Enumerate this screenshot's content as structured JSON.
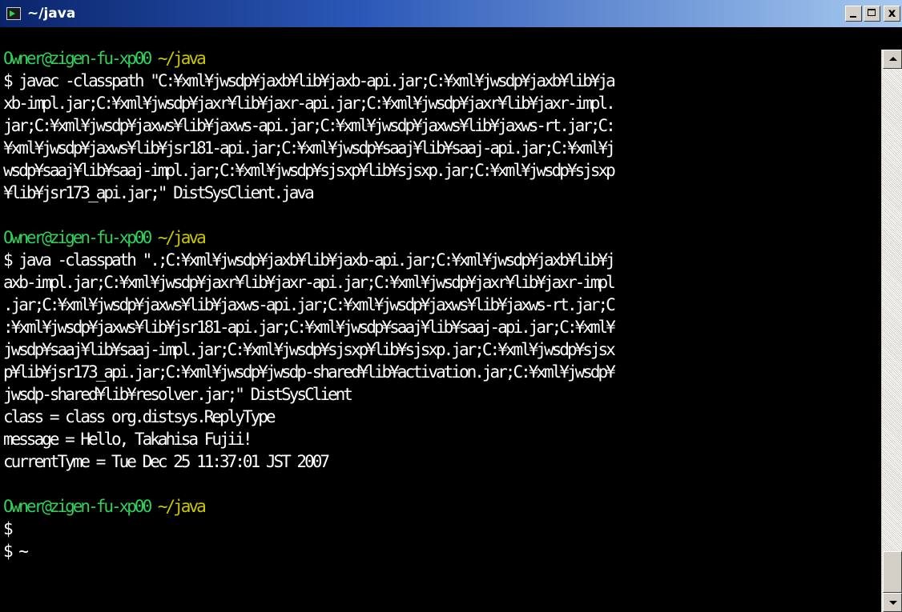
{
  "window": {
    "title": "~/java",
    "buttons": {
      "minimize": "_",
      "maximize": "□",
      "close": "x"
    },
    "colors": {
      "prompt_user": "#2fd15a",
      "prompt_path": "#c8c800",
      "text": "#ffffff",
      "background": "#000000"
    }
  },
  "console": {
    "lines": [
      {
        "type": "prompt",
        "user": "Owner@zigen-fu-xp00",
        "path": "~/java"
      },
      {
        "type": "text",
        "text": "$ javac -classpath \"C:¥xml¥jwsdp¥jaxb¥lib¥jaxb-api.jar;C:¥xml¥jwsdp¥jaxb¥lib¥ja"
      },
      {
        "type": "text",
        "text": "xb-impl.jar;C:¥xml¥jwsdp¥jaxr¥lib¥jaxr-api.jar;C:¥xml¥jwsdp¥jaxr¥lib¥jaxr-impl."
      },
      {
        "type": "text",
        "text": "jar;C:¥xml¥jwsdp¥jaxws¥lib¥jaxws-api.jar;C:¥xml¥jwsdp¥jaxws¥lib¥jaxws-rt.jar;C:"
      },
      {
        "type": "text",
        "text": "¥xml¥jwsdp¥jaxws¥lib¥jsr181-api.jar;C:¥xml¥jwsdp¥saaj¥lib¥saaj-api.jar;C:¥xml¥j"
      },
      {
        "type": "text",
        "text": "wsdp¥saaj¥lib¥saaj-impl.jar;C:¥xml¥jwsdp¥sjsxp¥lib¥sjsxp.jar;C:¥xml¥jwsdp¥sjsxp"
      },
      {
        "type": "text",
        "text": "¥lib¥jsr173_api.jar;\" DistSysClient.java"
      },
      {
        "type": "text",
        "text": ""
      },
      {
        "type": "prompt",
        "user": "Owner@zigen-fu-xp00",
        "path": "~/java"
      },
      {
        "type": "text",
        "text": "$ java -classpath \".;C:¥xml¥jwsdp¥jaxb¥lib¥jaxb-api.jar;C:¥xml¥jwsdp¥jaxb¥lib¥j"
      },
      {
        "type": "text",
        "text": "axb-impl.jar;C:¥xml¥jwsdp¥jaxr¥lib¥jaxr-api.jar;C:¥xml¥jwsdp¥jaxr¥lib¥jaxr-impl"
      },
      {
        "type": "text",
        "text": ".jar;C:¥xml¥jwsdp¥jaxws¥lib¥jaxws-api.jar;C:¥xml¥jwsdp¥jaxws¥lib¥jaxws-rt.jar;C"
      },
      {
        "type": "text",
        "text": ":¥xml¥jwsdp¥jaxws¥lib¥jsr181-api.jar;C:¥xml¥jwsdp¥saaj¥lib¥saaj-api.jar;C:¥xml¥"
      },
      {
        "type": "text",
        "text": "jwsdp¥saaj¥lib¥saaj-impl.jar;C:¥xml¥jwsdp¥sjsxp¥lib¥sjsxp.jar;C:¥xml¥jwsdp¥sjsx"
      },
      {
        "type": "text",
        "text": "p¥lib¥jsr173_api.jar;C:¥xml¥jwsdp¥jwsdp-shared¥lib¥activation.jar;C:¥xml¥jwsdp¥"
      },
      {
        "type": "text",
        "text": "jwsdp-shared¥lib¥resolver.jar;\" DistSysClient"
      },
      {
        "type": "text",
        "text": "class = class org.distsys.ReplyType"
      },
      {
        "type": "text",
        "text": "message = Hello, Takahisa Fujii!"
      },
      {
        "type": "text",
        "text": "currentTyme = Tue Dec 25 11:37:01 JST 2007"
      },
      {
        "type": "text",
        "text": ""
      },
      {
        "type": "prompt",
        "user": "Owner@zigen-fu-xp00",
        "path": "~/java"
      },
      {
        "type": "text",
        "text": "$"
      },
      {
        "type": "text",
        "text": "$ ~"
      }
    ]
  },
  "scrollbar": {
    "position_fraction": 1.0
  }
}
